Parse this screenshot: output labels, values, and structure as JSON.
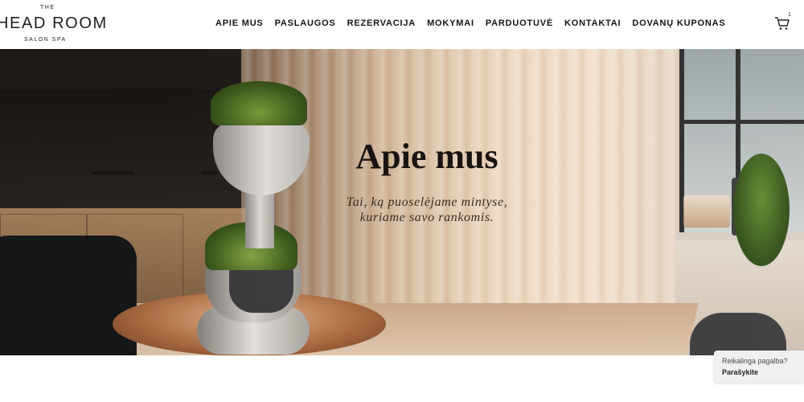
{
  "header": {
    "logo": {
      "the": "THE",
      "main": "HEAD ROOM",
      "sub": "SALON SPA"
    },
    "nav": [
      {
        "label": "APIE MUS"
      },
      {
        "label": "PASLAUGOS"
      },
      {
        "label": "REZERVACIJA"
      },
      {
        "label": "MOKYMAI"
      },
      {
        "label": "PARDUOTUVĖ"
      },
      {
        "label": "KONTAKTAI"
      },
      {
        "label": "DOVANŲ KUPONAS"
      }
    ],
    "cart": {
      "icon": "cart-icon",
      "count": "1"
    }
  },
  "hero": {
    "title": "Apie mus",
    "subtitle_line1": "Tai, ką puoselėjame mintyse,",
    "subtitle_line2": "kuriame savo rankomis."
  },
  "help_widget": {
    "line1": "Reikalinga pagalba?",
    "line2": "Parašykite"
  }
}
